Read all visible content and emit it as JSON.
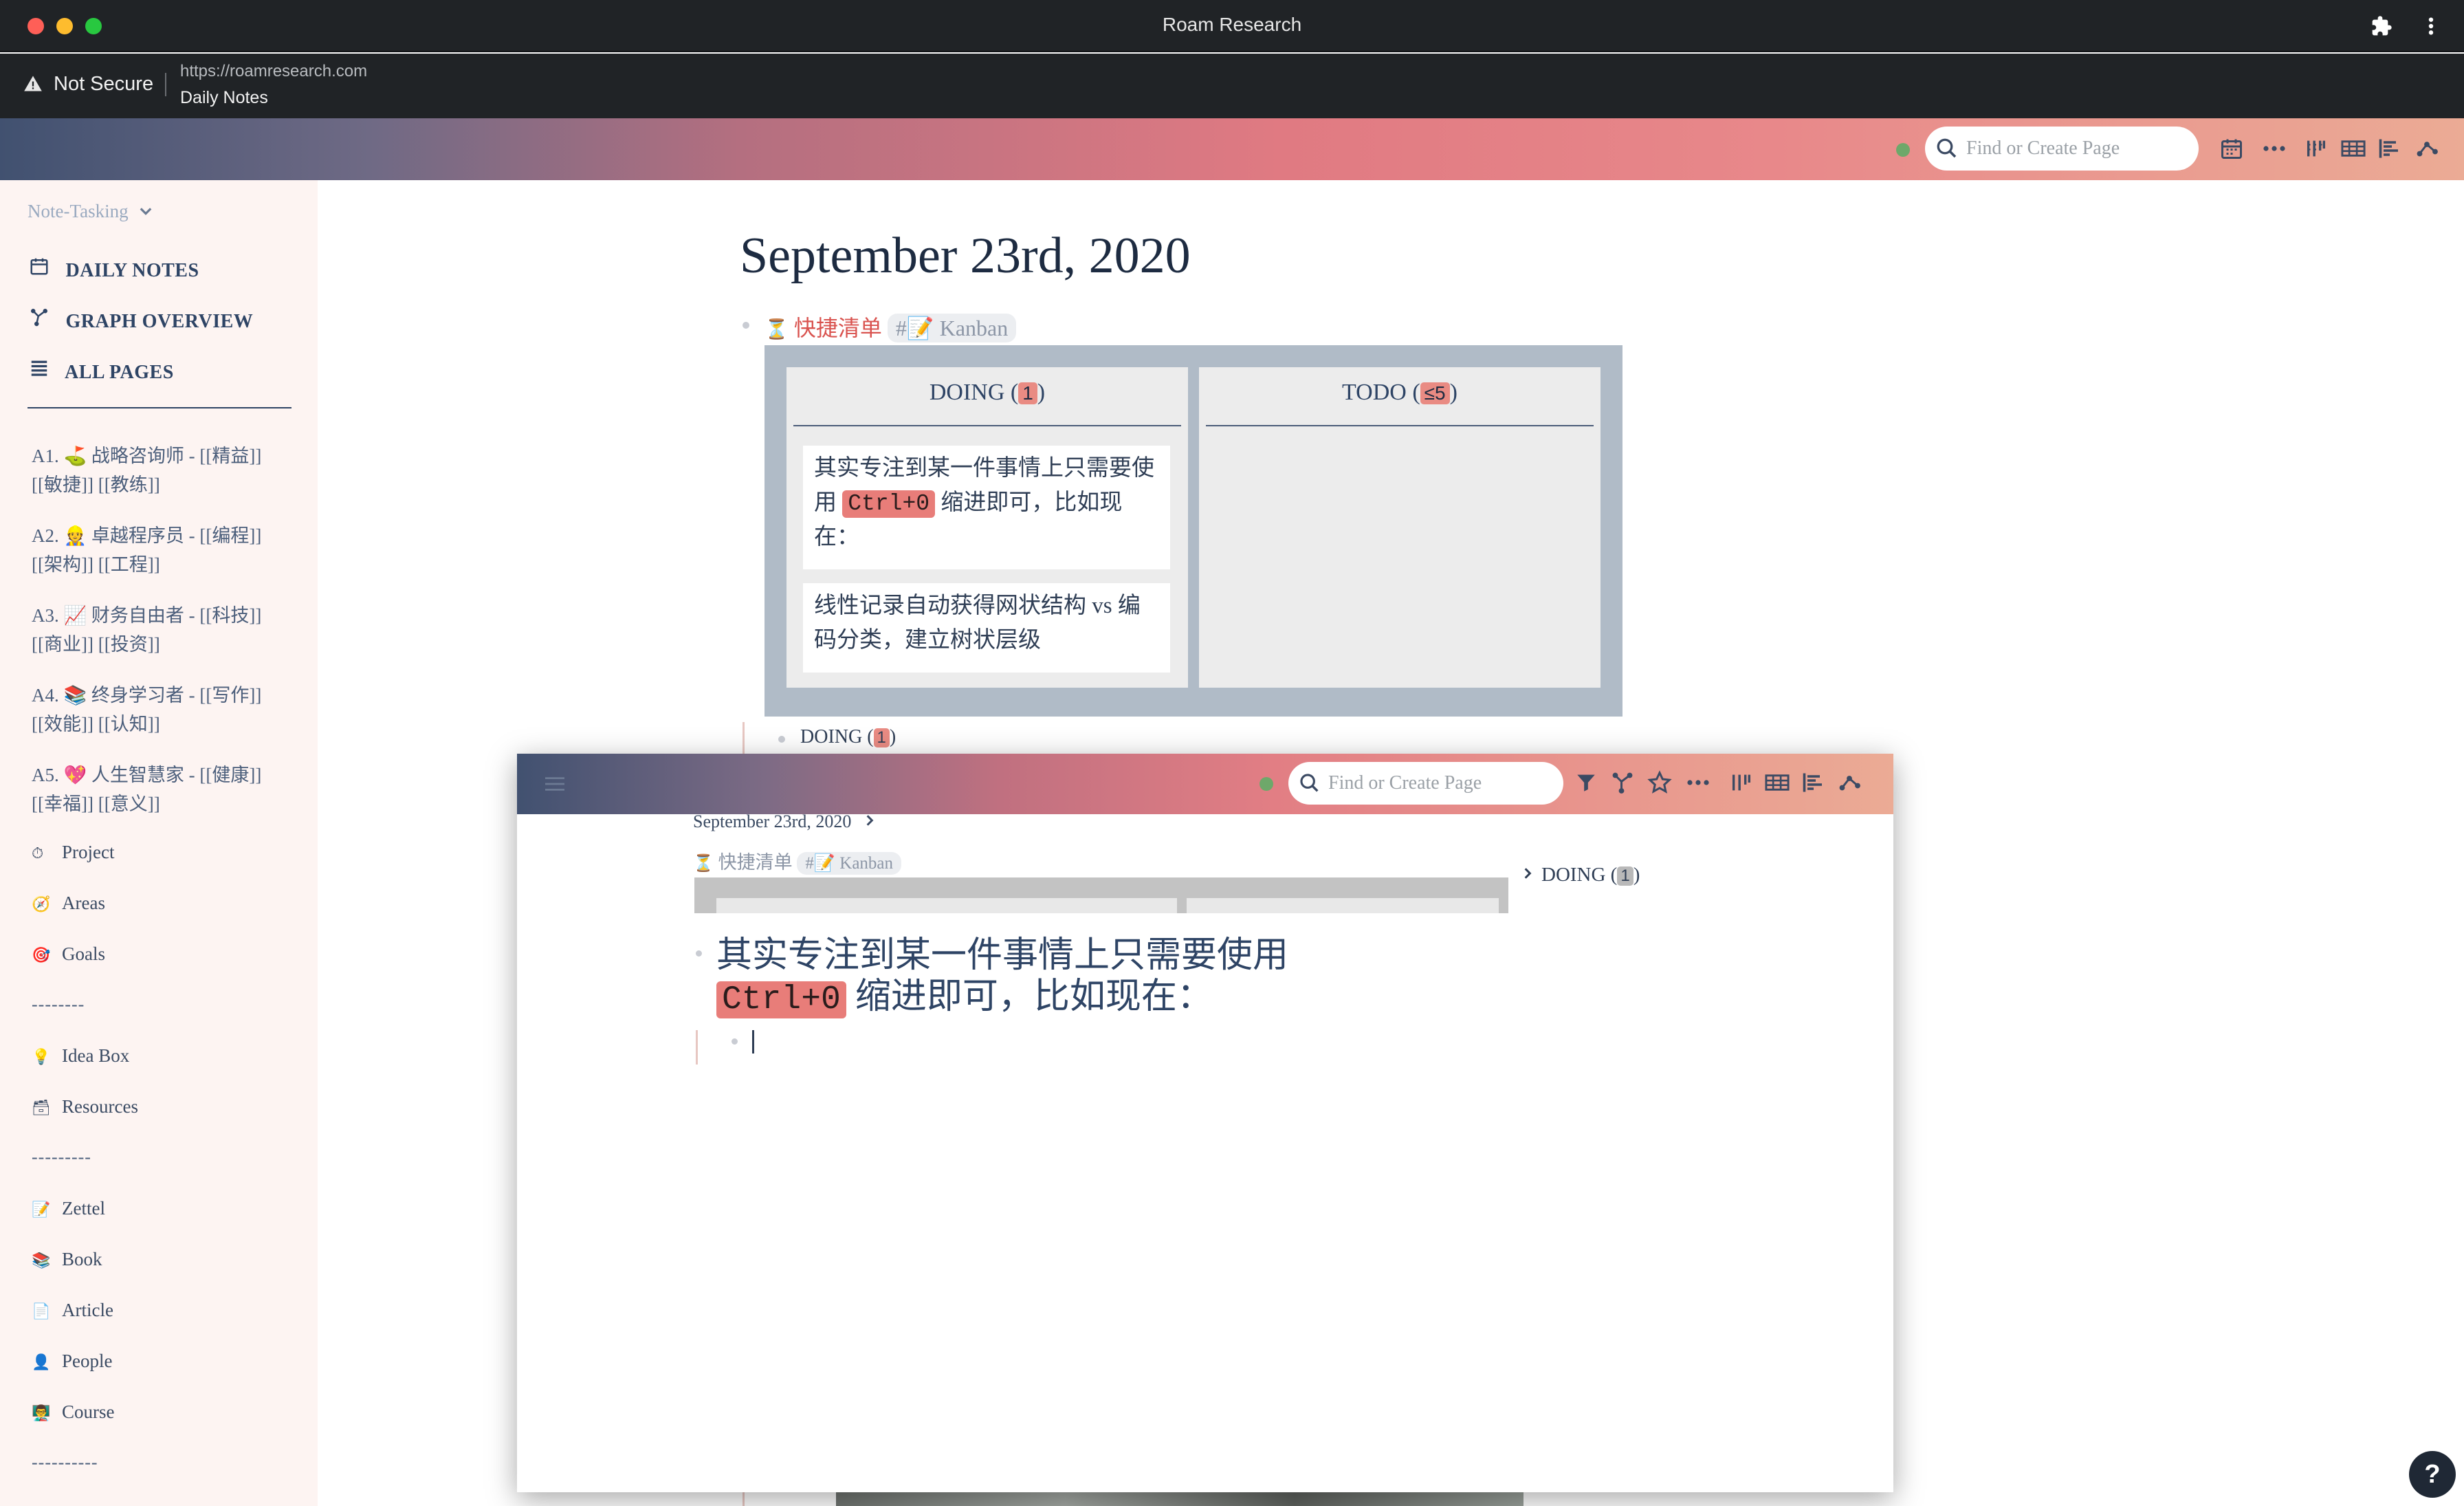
{
  "window": {
    "title": "Roam Research"
  },
  "browser": {
    "security": "Not Secure",
    "url": "https://roamresearch.com",
    "page": "Daily Notes"
  },
  "topbar": {
    "search_placeholder": "Find or Create Page"
  },
  "sidebar": {
    "graph_name": "Note-Tasking",
    "nav": [
      {
        "label": "DAILY NOTES",
        "icon": "calendar-icon"
      },
      {
        "label": "GRAPH OVERVIEW",
        "icon": "graph-icon"
      },
      {
        "label": "ALL PAGES",
        "icon": "list-icon"
      }
    ],
    "shortcuts": [
      {
        "line1": "A1. ⛳ 战略咨询师 - [[精益]]",
        "line2": "[[敏捷]] [[教练]]"
      },
      {
        "line1": "A2. 👷 卓越程序员 - [[编程]]",
        "line2": "[[架构]] [[工程]]"
      },
      {
        "line1": "A3. 📈 财务自由者 - [[科技]]",
        "line2": "[[商业]] [[投资]]"
      },
      {
        "line1": "A4. 📚 终身学习者 - [[写作]]",
        "line2": "[[效能]] [[认知]]"
      },
      {
        "line1": "A5. 💖 人生智慧家 - [[健康]]",
        "line2": "[[幸福]] [[意义]]"
      }
    ],
    "items_a": [
      {
        "label": "Project",
        "icon": "⏱"
      },
      {
        "label": "Areas",
        "icon": "🧭"
      },
      {
        "label": "Goals",
        "icon": "🎯"
      }
    ],
    "dash1": "--------",
    "items_b": [
      {
        "label": "Idea Box",
        "icon": "💡"
      },
      {
        "label": "Resources",
        "icon": "🗃"
      }
    ],
    "dash2": "---------",
    "items_c": [
      {
        "label": "Zettel",
        "icon": "📝"
      },
      {
        "label": "Book",
        "icon": "📚"
      },
      {
        "label": "Article",
        "icon": "📄"
      },
      {
        "label": "People",
        "icon": "👤"
      },
      {
        "label": "Course",
        "icon": "👨‍🏫"
      }
    ],
    "dash3": "----------"
  },
  "main": {
    "title": "September 23rd, 2020",
    "block_link": "快捷清单",
    "block_tag": "#📝 Kanban",
    "kanban": {
      "col1": {
        "title": "DOING (",
        "count": "1",
        "close": ")"
      },
      "col2": {
        "title": "TODO (",
        "count": "≤5",
        "close": ")"
      },
      "cards": [
        {
          "pre": "其实专注到某一件事情上只需要使用",
          "code": "Ctrl+0",
          "post": "缩进即可，比如现在："
        },
        {
          "text": "线性记录自动获得网状结构 vs 编码分类，建立树状层级"
        }
      ]
    },
    "doing_row": {
      "label": "DOING (",
      "count": "1",
      "close": ")"
    }
  },
  "zoom": {
    "search_placeholder": "Find or Create Page",
    "breadcrumb": "September 23rd, 2020",
    "tagline_link": "快捷清单",
    "tagline_tag": "#📝 Kanban",
    "block": {
      "pre": "其实专注到某一件事情上只需要使用",
      "code": "Ctrl+0",
      "post": "缩进即可，比如现在："
    },
    "sidebar_doing": {
      "label": "DOING (",
      "count": "1",
      "close": ")"
    }
  },
  "help": {
    "label": "?"
  },
  "colors": {
    "accent": "#e98b83",
    "link": "#d9534f",
    "nav": "#2e4465"
  }
}
